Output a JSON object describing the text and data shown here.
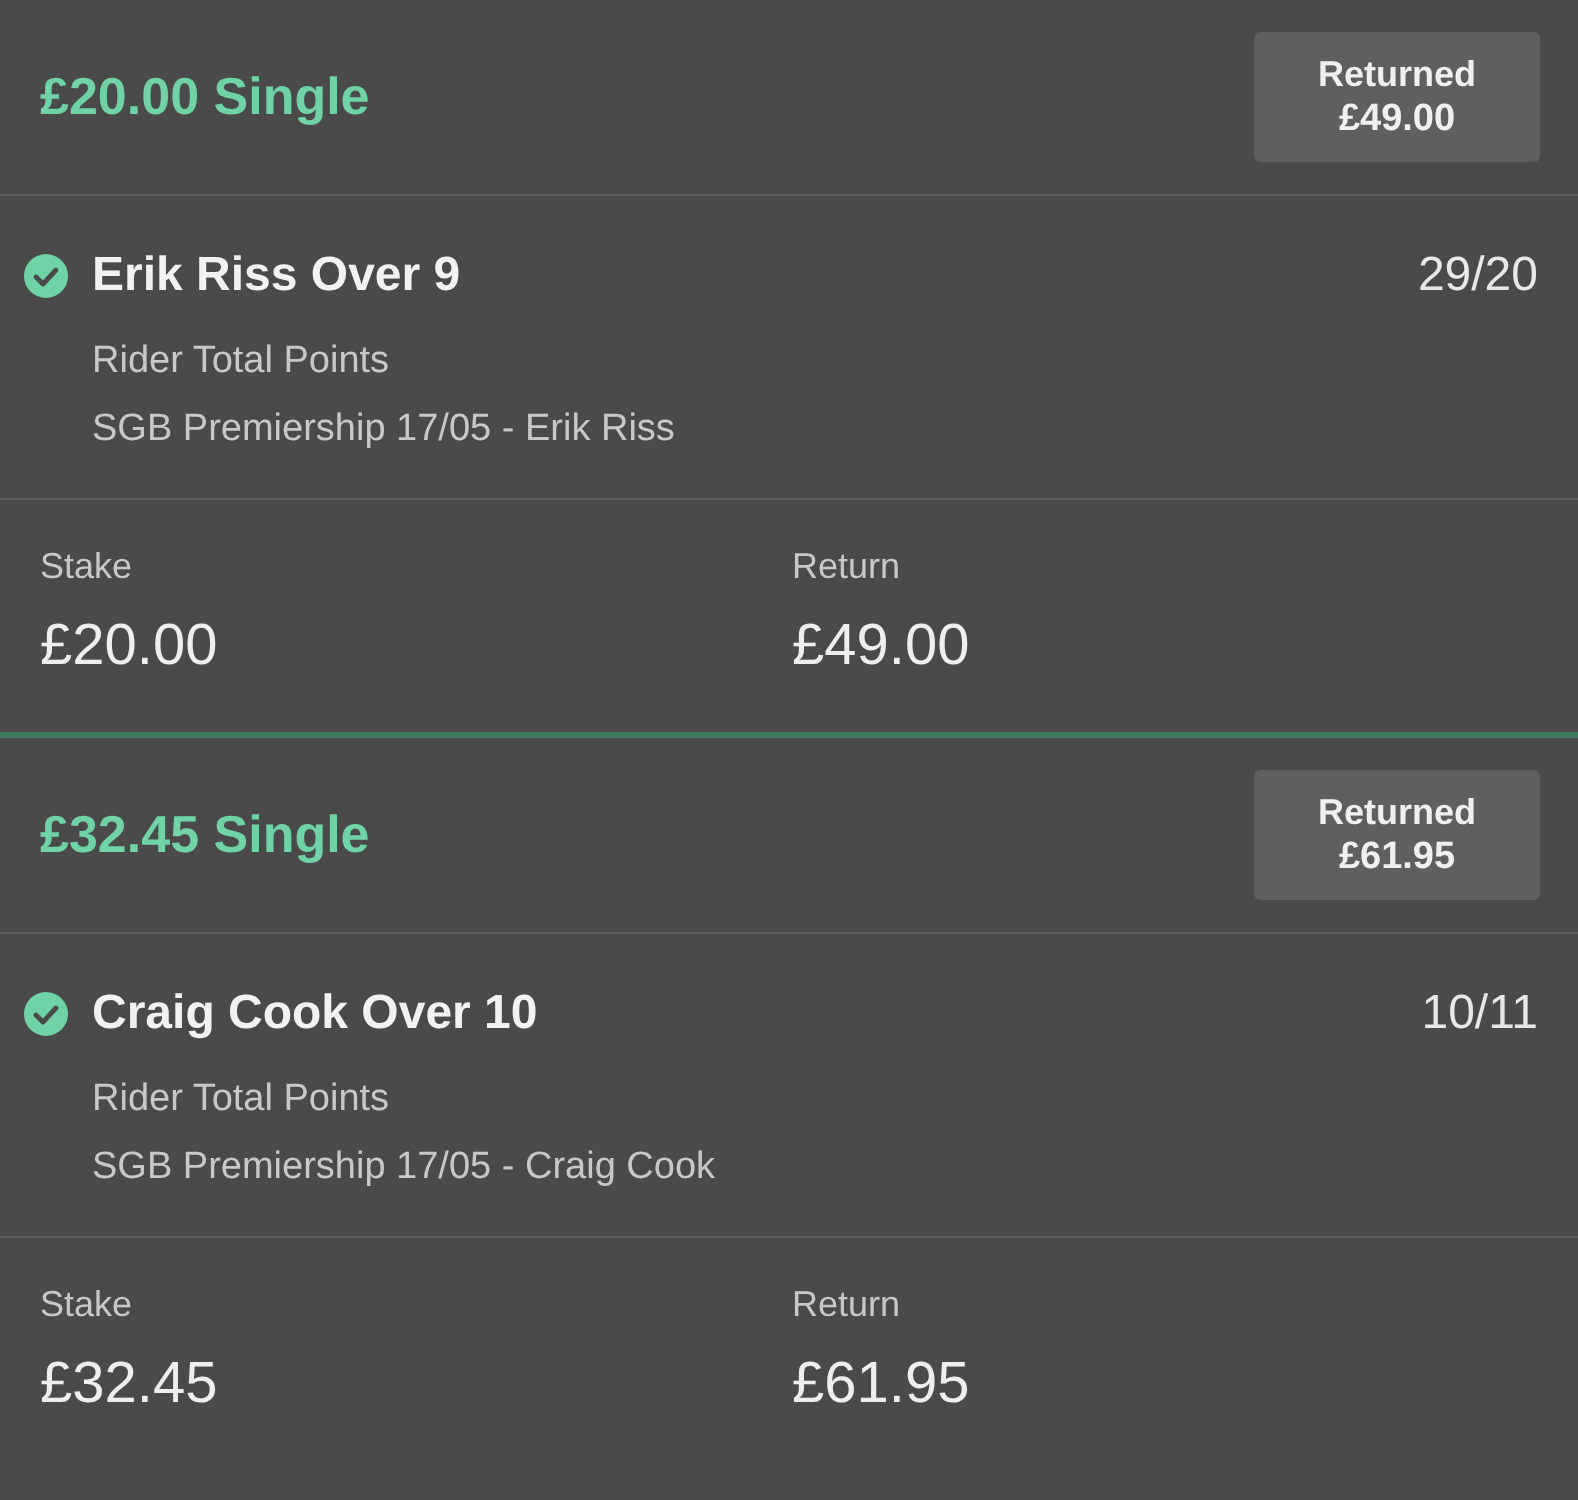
{
  "bets": [
    {
      "title": "£20.00 Single",
      "badge": {
        "label": "Returned",
        "amount": "£49.00"
      },
      "selection": {
        "won": true,
        "name": "Erik Riss Over 9",
        "odds": "29/20",
        "market": "Rider Total Points",
        "event": "SGB Premiership 17/05 - Erik Riss"
      },
      "stake_label": "Stake",
      "stake": "£20.00",
      "return_label": "Return",
      "return": "£49.00"
    },
    {
      "title": "£32.45 Single",
      "badge": {
        "label": "Returned",
        "amount": "£61.95"
      },
      "selection": {
        "won": true,
        "name": "Craig Cook Over 10",
        "odds": "10/11",
        "market": "Rider Total Points",
        "event": "SGB Premiership 17/05 - Craig Cook"
      },
      "stake_label": "Stake",
      "stake": "£32.45",
      "return_label": "Return",
      "return": "£61.95"
    }
  ]
}
